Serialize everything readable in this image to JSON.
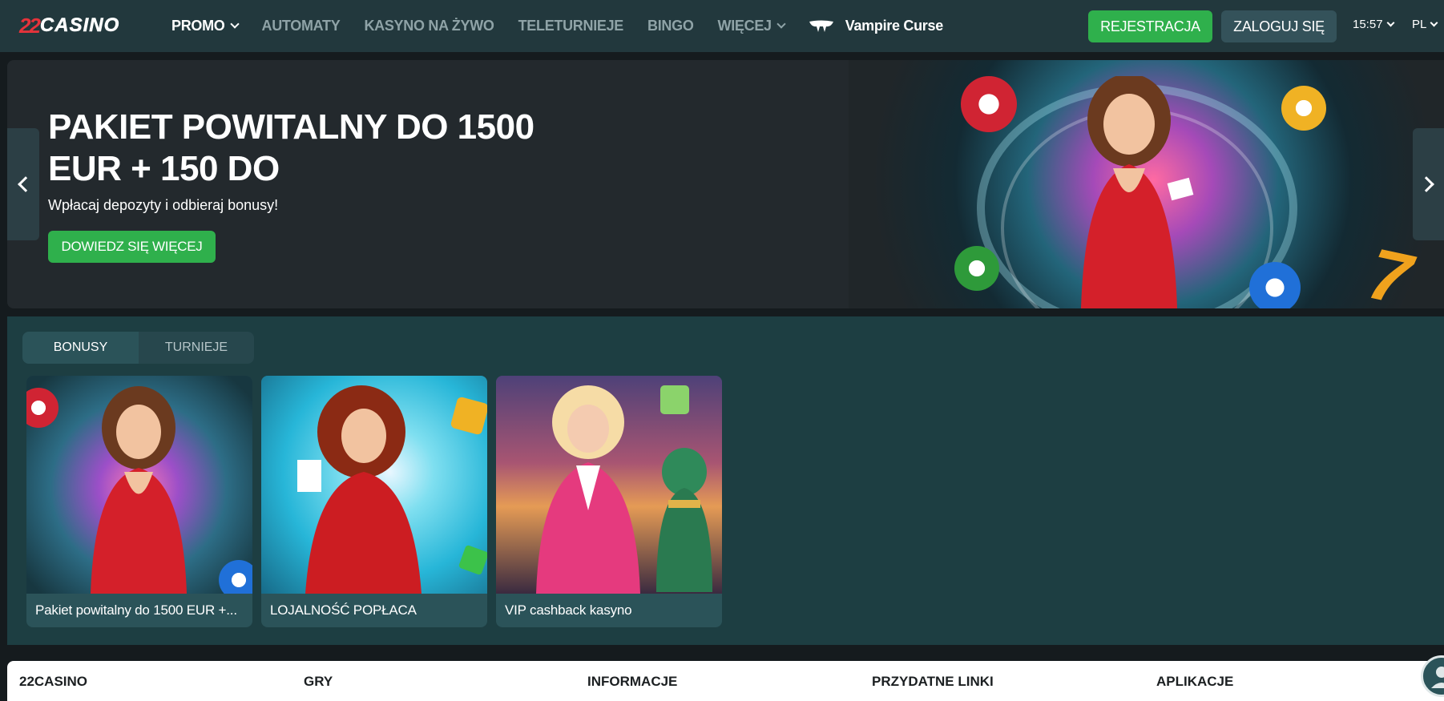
{
  "header": {
    "logo_number": "22",
    "logo_text": "CASINO",
    "nav": [
      {
        "label": "PROMO",
        "dropdown": true,
        "active": true
      },
      {
        "label": "AUTOMATY",
        "dropdown": false
      },
      {
        "label": "KASYNO NA ŻYWO",
        "dropdown": false
      },
      {
        "label": "TELETURNIEJE",
        "dropdown": false
      },
      {
        "label": "BINGO",
        "dropdown": false
      },
      {
        "label": "WIĘCEJ",
        "dropdown": true
      }
    ],
    "featured_game": "Vampire Curse",
    "register_label": "REJESTRACJA",
    "login_label": "ZALOGUJ SIĘ",
    "time": "15:57",
    "language": "PL"
  },
  "hero": {
    "title": "PAKIET POWITALNY DO 1500 EUR + 150 DO",
    "subtitle": "Wpłacaj depozyty i odbieraj bonusy!",
    "cta_label": "DOWIEDZ SIĘ WIĘCEJ"
  },
  "promo": {
    "tabs": [
      {
        "label": "BONUSY",
        "active": true
      },
      {
        "label": "TURNIEJE",
        "active": false
      }
    ],
    "cards": [
      {
        "label": "Pakiet powitalny do 1500 EUR +..."
      },
      {
        "label": "LOJALNOŚĆ POPŁACA"
      },
      {
        "label": "VIP cashback kasyno"
      }
    ]
  },
  "footer": {
    "columns": [
      {
        "title": "22CASINO"
      },
      {
        "title": "GRY"
      },
      {
        "title": "INFORMACJE"
      },
      {
        "title": "PRZYDATNE LINKI"
      },
      {
        "title": "APLIKACJE"
      }
    ]
  },
  "colors": {
    "header_bg": "#22383d",
    "accent_green": "#2fb04c",
    "secondary_button": "#34525a",
    "promo_bg": "#1d3e42",
    "logo_red": "#e5333b"
  }
}
